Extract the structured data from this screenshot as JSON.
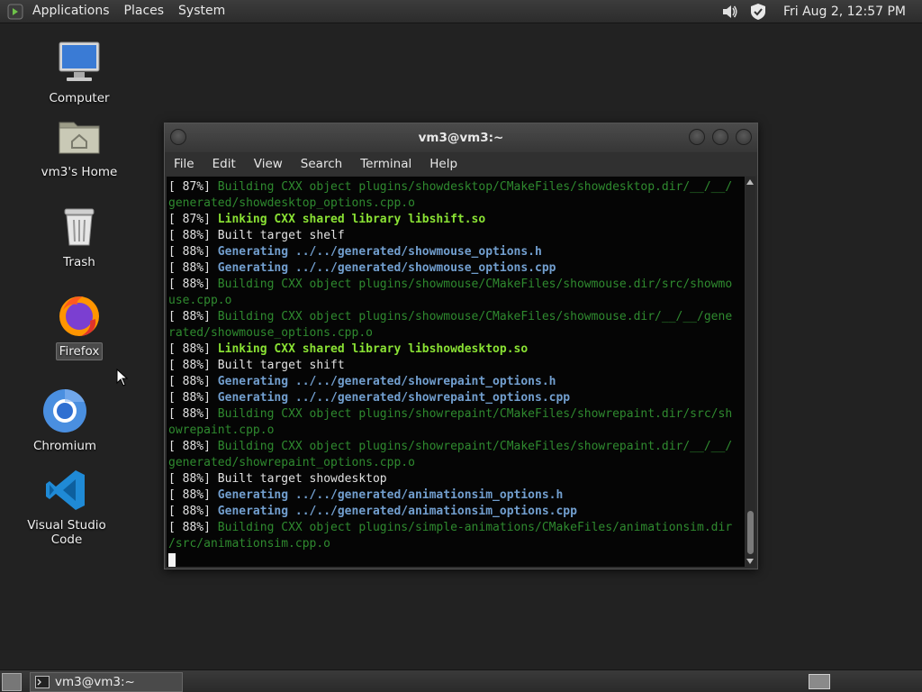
{
  "top_panel": {
    "menu": [
      "Applications",
      "Places",
      "System"
    ],
    "clock": "Fri Aug  2, 12:57 PM",
    "icons": [
      "app-icon",
      "volume-icon",
      "shield-icon"
    ]
  },
  "desktop": {
    "icons": [
      {
        "label": "Computer",
        "icon": "computer-icon"
      },
      {
        "label": "vm3's Home",
        "icon": "home-folder-icon"
      },
      {
        "label": "Trash",
        "icon": "trash-icon"
      },
      {
        "label": "Firefox",
        "icon": "firefox-icon"
      },
      {
        "label": "Chromium",
        "icon": "chromium-icon"
      },
      {
        "label": "Visual Studio Code",
        "icon": "vscode-icon"
      }
    ]
  },
  "terminal": {
    "title": "vm3@vm3:~",
    "menu": [
      "File",
      "Edit",
      "View",
      "Search",
      "Terminal",
      "Help"
    ],
    "colors": {
      "green": "#2f8a2f",
      "bright_green": "#8ae234",
      "blue": "#729fcf",
      "white": "#e2e2e2"
    },
    "lines": [
      {
        "prefix": "[ 87%] ",
        "text": "Building CXX object plugins/showdesktop/CMakeFiles/showdesktop.dir/__/__/",
        "style": "g"
      },
      {
        "prefix": "",
        "text": "generated/showdesktop_options.cpp.o",
        "style": "g"
      },
      {
        "prefix": "[ 87%] ",
        "text": "Linking CXX shared library libshift.so",
        "style": "lg"
      },
      {
        "prefix": "[ 88%] ",
        "text": "Built target shelf",
        "style": "w"
      },
      {
        "prefix": "[ 88%] ",
        "text": "Generating ../../generated/showmouse_options.h",
        "style": "bl"
      },
      {
        "prefix": "[ 88%] ",
        "text": "Generating ../../generated/showmouse_options.cpp",
        "style": "bl"
      },
      {
        "prefix": "[ 88%] ",
        "text": "Building CXX object plugins/showmouse/CMakeFiles/showmouse.dir/src/showmo",
        "style": "g"
      },
      {
        "prefix": "",
        "text": "use.cpp.o",
        "style": "g"
      },
      {
        "prefix": "[ 88%] ",
        "text": "Building CXX object plugins/showmouse/CMakeFiles/showmouse.dir/__/__/gene",
        "style": "g"
      },
      {
        "prefix": "",
        "text": "rated/showmouse_options.cpp.o",
        "style": "g"
      },
      {
        "prefix": "[ 88%] ",
        "text": "Linking CXX shared library libshowdesktop.so",
        "style": "lg"
      },
      {
        "prefix": "[ 88%] ",
        "text": "Built target shift",
        "style": "w"
      },
      {
        "prefix": "[ 88%] ",
        "text": "Generating ../../generated/showrepaint_options.h",
        "style": "bl"
      },
      {
        "prefix": "[ 88%] ",
        "text": "Generating ../../generated/showrepaint_options.cpp",
        "style": "bl"
      },
      {
        "prefix": "[ 88%] ",
        "text": "Building CXX object plugins/showrepaint/CMakeFiles/showrepaint.dir/src/sh",
        "style": "g"
      },
      {
        "prefix": "",
        "text": "owrepaint.cpp.o",
        "style": "g"
      },
      {
        "prefix": "[ 88%] ",
        "text": "Building CXX object plugins/showrepaint/CMakeFiles/showrepaint.dir/__/__/",
        "style": "g"
      },
      {
        "prefix": "",
        "text": "generated/showrepaint_options.cpp.o",
        "style": "g"
      },
      {
        "prefix": "[ 88%] ",
        "text": "Built target showdesktop",
        "style": "w"
      },
      {
        "prefix": "[ 88%] ",
        "text": "Generating ../../generated/animationsim_options.h",
        "style": "bl"
      },
      {
        "prefix": "[ 88%] ",
        "text": "Generating ../../generated/animationsim_options.cpp",
        "style": "bl"
      },
      {
        "prefix": "[ 88%] ",
        "text": "Building CXX object plugins/simple-animations/CMakeFiles/animationsim.dir",
        "style": "g"
      },
      {
        "prefix": "",
        "text": "/src/animationsim.cpp.o",
        "style": "g"
      }
    ]
  },
  "bottom_panel": {
    "task_label": "vm3@vm3:~"
  }
}
